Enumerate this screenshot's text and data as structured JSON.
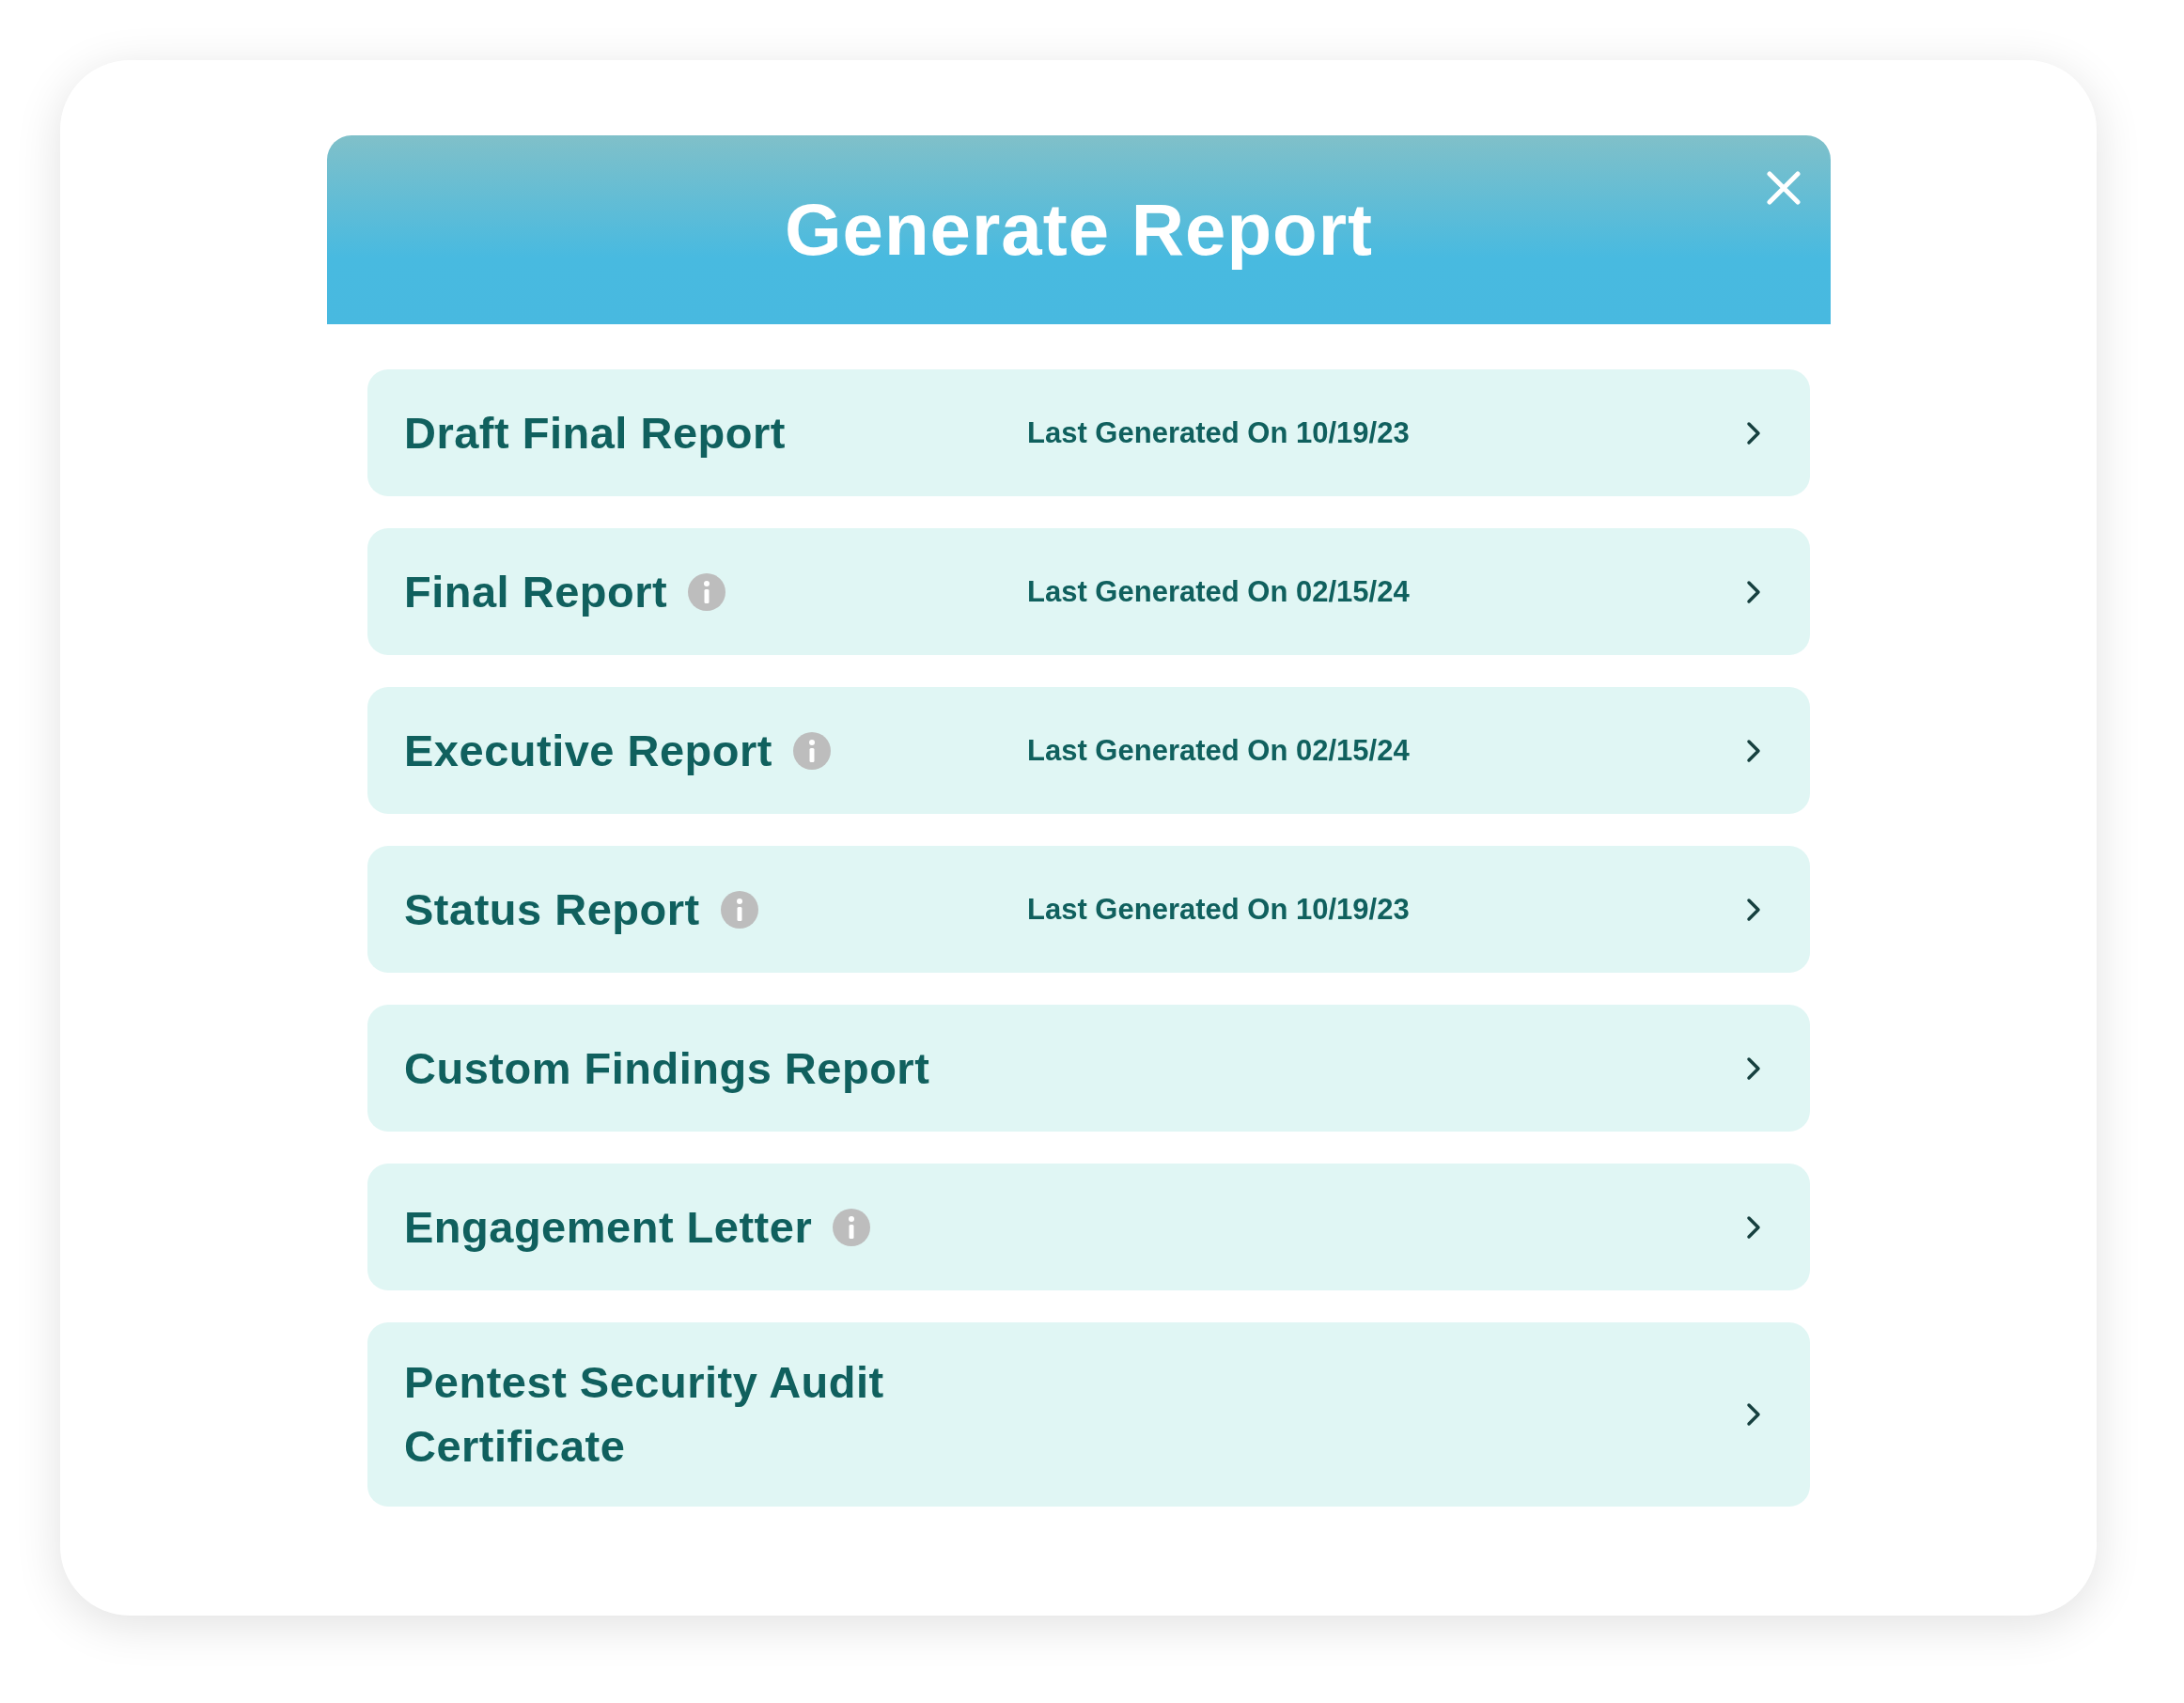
{
  "dialog": {
    "title": "Generate Report"
  },
  "reports": [
    {
      "title": "Draft Final Report",
      "info": false,
      "last_generated": "Last Generated On 10/19/23"
    },
    {
      "title": "Final Report",
      "info": true,
      "last_generated": "Last Generated On 02/15/24"
    },
    {
      "title": "Executive Report",
      "info": true,
      "last_generated": "Last Generated On 02/15/24"
    },
    {
      "title": "Status Report",
      "info": true,
      "last_generated": "Last Generated On 10/19/23"
    },
    {
      "title": "Custom Findings Report",
      "info": false
    },
    {
      "title": "Engagement Letter",
      "info": true
    },
    {
      "title": "Pentest Security Audit Certificate",
      "info": false
    }
  ]
}
